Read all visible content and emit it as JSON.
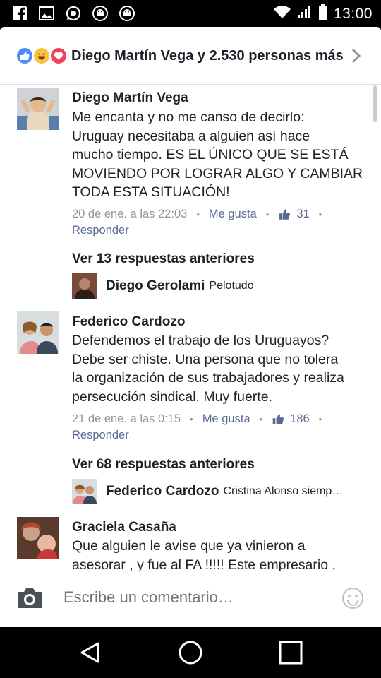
{
  "status_bar": {
    "time": "13:00",
    "icons": [
      "facebook-icon",
      "gallery-icon",
      "whatsapp-icon",
      "android-icon",
      "android-icon",
      "wifi-icon",
      "signal-icon",
      "battery-icon"
    ]
  },
  "reactions": {
    "summary": "Diego Martín Vega y 2.530 personas más",
    "types": [
      "like",
      "haha",
      "love"
    ]
  },
  "comments": [
    {
      "author": "Diego Martín Vega",
      "lines": [
        "Me encanta y no me canso de decirlo:",
        "Uruguay necesitaba a alguien así hace",
        "mucho tiempo. ES EL ÚNICO QUE SE ESTÁ",
        "MOVIENDO POR LOGRAR ALGO Y CAMBIAR",
        "TODA ESTA SITUACIÓN!"
      ],
      "timestamp": "20 de ene. a las 22:03",
      "like_label": "Me gusta",
      "like_count": "31",
      "reply_label": "Responder",
      "previous_replies": "Ver 13 respuestas anteriores",
      "reply_preview": {
        "author": "Diego Gerolami",
        "text": "Pelotudo"
      }
    },
    {
      "author": "Federico Cardozo",
      "lines": [
        "Defendemos el trabajo de los Uruguayos?",
        "Debe ser chiste. Una persona que no tolera",
        "la organización de sus trabajadores y realiza",
        "persecución sindical. Muy fuerte."
      ],
      "timestamp": "21 de ene. a las 0:15",
      "like_label": "Me gusta",
      "like_count": "186",
      "reply_label": "Responder",
      "previous_replies": "Ver 68 respuestas anteriores",
      "reply_preview": {
        "author": "Federico Cardozo",
        "text": "Cristina Alonso siemp…"
      }
    },
    {
      "author": "Graciela Casaña",
      "lines": [
        "Que alguien le avise que ya vinieron a",
        "asesorar , y fue al FA !!!!!  Este empresario ,"
      ]
    }
  ],
  "composer": {
    "placeholder": "Escribe un comentario…"
  },
  "colors": {
    "link": "#5b6c94",
    "meta": "#90949c",
    "text": "#1d2129",
    "like_blue": "#4c8ef7",
    "love_red": "#f0415c",
    "haha_yellow": "#f7c33b"
  }
}
